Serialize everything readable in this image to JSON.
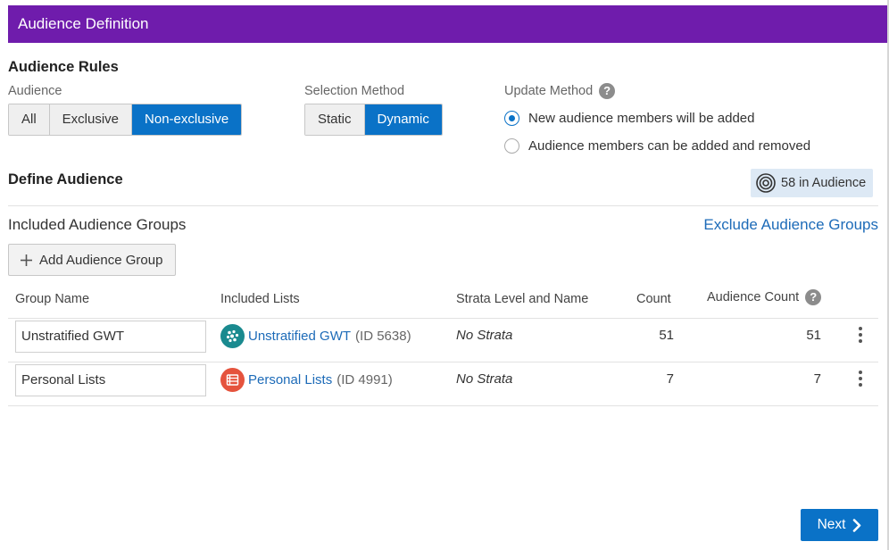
{
  "header": {
    "title": "Audience Definition"
  },
  "rules": {
    "title": "Audience Rules",
    "audience": {
      "label": "Audience",
      "options": [
        "All",
        "Exclusive",
        "Non-exclusive"
      ],
      "selected": "Non-exclusive"
    },
    "selection": {
      "label": "Selection Method",
      "options": [
        "Static",
        "Dynamic"
      ],
      "selected": "Dynamic"
    },
    "update": {
      "label": "Update Method",
      "help": "?",
      "options": [
        "New audience members will be added",
        "Audience members can be added and removed"
      ],
      "selected": "New audience members will be added"
    }
  },
  "define": {
    "title": "Define Audience",
    "badge": "58 in Audience",
    "included_title": "Included Audience Groups",
    "exclude_link": "Exclude Audience Groups",
    "add_button": "Add Audience Group"
  },
  "table": {
    "headers": [
      "Group Name",
      "Included Lists",
      "Strata Level and Name",
      "Count",
      "Audience Count"
    ],
    "header_help": "?",
    "rows": [
      {
        "group": "Unstratified GWT",
        "list_name": "Unstratified GWT",
        "list_id": "(ID 5638)",
        "icon": "dots-icon",
        "icon_color": "#1a8a8f",
        "strata": "No Strata",
        "count": "51",
        "audience_count": "51"
      },
      {
        "group": "Personal Lists",
        "list_name": "Personal Lists",
        "list_id": "(ID 4991)",
        "icon": "list-icon",
        "icon_color": "#e5533d",
        "strata": "No Strata",
        "count": "7",
        "audience_count": "7"
      }
    ]
  },
  "footer": {
    "next": "Next"
  },
  "colors": {
    "header": "#6f1cac",
    "accent": "#0a72c7",
    "link": "#1d6bb8",
    "badge_bg": "#dde9f5"
  }
}
